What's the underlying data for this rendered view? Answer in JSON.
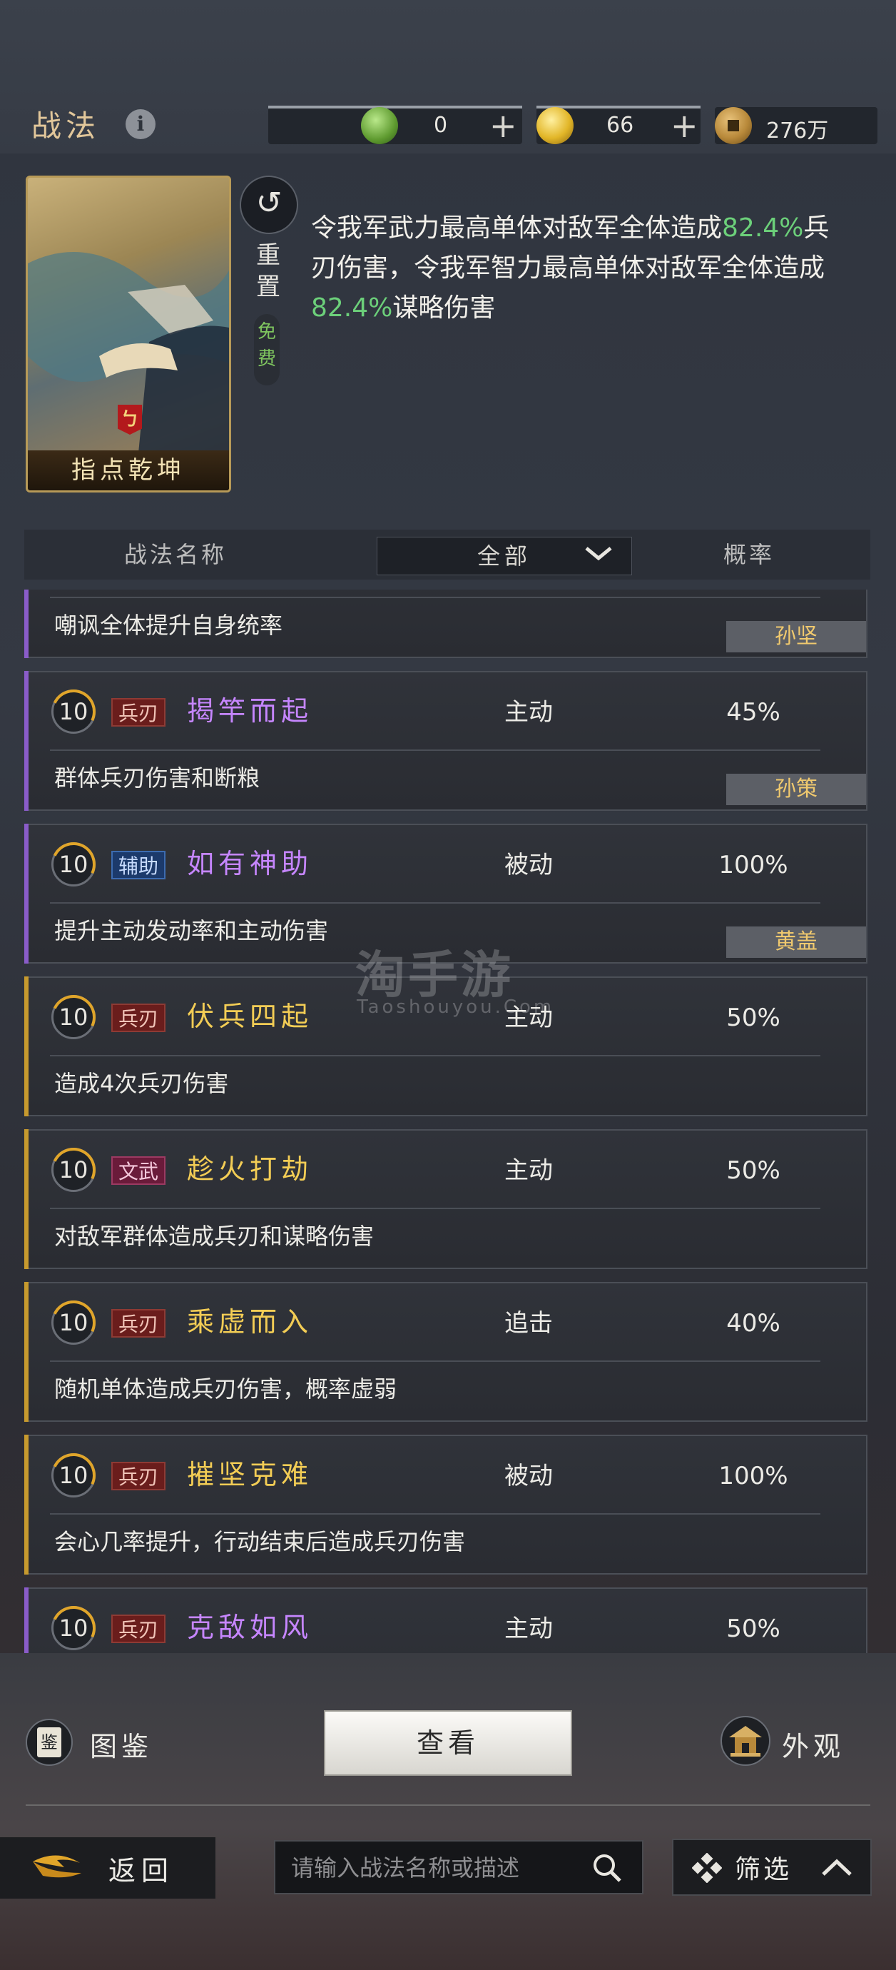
{
  "header": {
    "title": "战法",
    "resources": [
      {
        "name": "jade",
        "value": "0",
        "has_plus": true,
        "color": "#7cc24a"
      },
      {
        "name": "gold",
        "value": "66",
        "has_plus": true,
        "color": "#e2b628"
      },
      {
        "name": "copper",
        "value": "276万",
        "has_plus": false,
        "color": "#b8893a"
      }
    ]
  },
  "skill_card": {
    "name": "指点乾坤",
    "reset_label": "重置",
    "free_label": "免费",
    "desc_parts": [
      "令我军武力最高单体对敌军全体造成",
      "82.4%",
      "兵刃伤害，令我军智力最高单体对敌军全体造成",
      "82.4%",
      "谋略伤害"
    ]
  },
  "table_header": {
    "col_name": "战法名称",
    "filter_value": "全部",
    "col_prob": "概率"
  },
  "partial_top": {
    "effect": "嘲讽全体提升自身统率",
    "general": "孙坚"
  },
  "skills": [
    {
      "level": "10",
      "type": "兵刃",
      "type_class": "blade",
      "name": "揭竿而起",
      "name_color": "purple",
      "mode": "主动",
      "prob": "45%",
      "effect": "群体兵刃伤害和断粮",
      "general": "孙策",
      "accent": "#8a5cc9"
    },
    {
      "level": "10",
      "type": "辅助",
      "type_class": "assist",
      "name": "如有神助",
      "name_color": "purple",
      "mode": "被动",
      "prob": "100%",
      "effect": "提升主动发动率和主动伤害",
      "general": "黄盖",
      "accent": "#8a5cc9"
    },
    {
      "level": "10",
      "type": "兵刃",
      "type_class": "blade",
      "name": "伏兵四起",
      "name_color": "gold",
      "mode": "主动",
      "prob": "50%",
      "effect": "造成4次兵刃伤害",
      "general": "",
      "accent": "#c79a2e"
    },
    {
      "level": "10",
      "type": "文武",
      "type_class": "civil",
      "name": "趁火打劫",
      "name_color": "gold",
      "mode": "主动",
      "prob": "50%",
      "effect": "对敌军群体造成兵刃和谋略伤害",
      "general": "",
      "accent": "#c79a2e"
    },
    {
      "level": "10",
      "type": "兵刃",
      "type_class": "blade",
      "name": "乘虚而入",
      "name_color": "gold",
      "mode": "追击",
      "prob": "40%",
      "effect": "随机单体造成兵刃伤害，概率虚弱",
      "general": "",
      "accent": "#c79a2e"
    },
    {
      "level": "10",
      "type": "兵刃",
      "type_class": "blade",
      "name": "摧坚克难",
      "name_color": "gold",
      "mode": "被动",
      "prob": "100%",
      "effect": "会心几率提升，行动结束后造成兵刃伤害",
      "general": "",
      "accent": "#c79a2e"
    },
    {
      "level": "10",
      "type": "兵刃",
      "type_class": "blade",
      "name": "克敌如风",
      "name_color": "purple",
      "mode": "主动",
      "prob": "50%",
      "effect": "",
      "general": "",
      "accent": "#8a5cc9"
    }
  ],
  "footer": {
    "codex_icon_char": "鉴",
    "codex_label": "图鉴",
    "view_label": "查看",
    "appearance_label": "外观",
    "back_label": "返回",
    "search_placeholder": "请输入战法名称或描述",
    "filter_label": "筛选"
  },
  "watermark": {
    "main": "淘手游",
    "sub": "Taoshouyou.Com"
  }
}
